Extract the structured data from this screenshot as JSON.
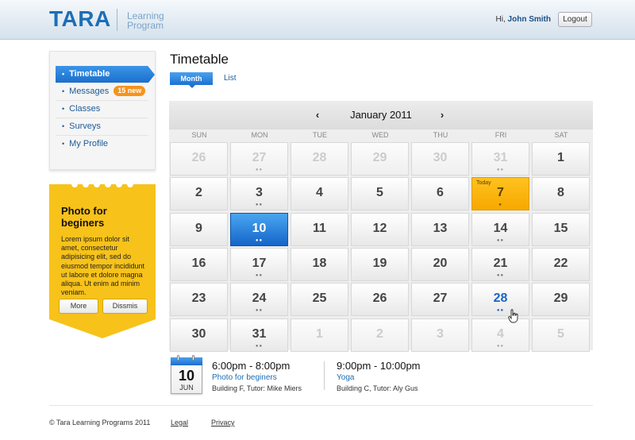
{
  "header": {
    "logo": "TARA",
    "logo_sub_1": "Learning",
    "logo_sub_2": "Program",
    "greeting": "Hi,",
    "user_name": "John Smith",
    "logout_label": "Logout"
  },
  "sidebar": {
    "items": [
      {
        "label": "Timetable",
        "active": true
      },
      {
        "label": "Messages",
        "badge": "15 new"
      },
      {
        "label": "Classes"
      },
      {
        "label": "Surveys"
      },
      {
        "label": "My Profile"
      }
    ]
  },
  "promo": {
    "title": "Photo for beginers",
    "body": "Lorem ipsum dolor sit amet, consectetur adipisicing elit, sed do eiusmod tempor incididunt ut labore et dolore magna aliqua. Ut enim ad minim veniam.",
    "more_label": "More",
    "dismiss_label": "Dissmis"
  },
  "main": {
    "title": "Timetable",
    "tab_month": "Month",
    "tab_list": "List"
  },
  "calendar": {
    "month": "January 2011",
    "prev_icon": "chevron-left-icon",
    "next_icon": "chevron-right-icon",
    "weekdays": [
      "SUN",
      "MON",
      "TUE",
      "WED",
      "THU",
      "FRI",
      "SAT"
    ],
    "today_label": "Today",
    "weeks": [
      [
        {
          "d": "26",
          "f": 1
        },
        {
          "d": "27",
          "f": 1,
          "e": 2
        },
        {
          "d": "28",
          "f": 1
        },
        {
          "d": "29",
          "f": 1
        },
        {
          "d": "30",
          "f": 1
        },
        {
          "d": "31",
          "f": 1,
          "e": 2
        },
        {
          "d": "1"
        }
      ],
      [
        {
          "d": "2"
        },
        {
          "d": "3",
          "e": 2
        },
        {
          "d": "4"
        },
        {
          "d": "5"
        },
        {
          "d": "6"
        },
        {
          "d": "7",
          "e": 1,
          "today": 1
        },
        {
          "d": "8"
        }
      ],
      [
        {
          "d": "9"
        },
        {
          "d": "10",
          "e": 2,
          "sel": 1
        },
        {
          "d": "11"
        },
        {
          "d": "12"
        },
        {
          "d": "13"
        },
        {
          "d": "14",
          "e": 2
        },
        {
          "d": "15"
        }
      ],
      [
        {
          "d": "16"
        },
        {
          "d": "17",
          "e": 2
        },
        {
          "d": "18"
        },
        {
          "d": "19"
        },
        {
          "d": "20"
        },
        {
          "d": "21",
          "e": 2
        },
        {
          "d": "22"
        }
      ],
      [
        {
          "d": "23"
        },
        {
          "d": "24",
          "e": 2
        },
        {
          "d": "25"
        },
        {
          "d": "26"
        },
        {
          "d": "27"
        },
        {
          "d": "28",
          "e": 2,
          "hl": 1
        },
        {
          "d": "29"
        }
      ],
      [
        {
          "d": "30"
        },
        {
          "d": "31",
          "e": 2
        },
        {
          "d": "1",
          "f": 1
        },
        {
          "d": "2",
          "f": 1
        },
        {
          "d": "3",
          "f": 1
        },
        {
          "d": "4",
          "f": 1,
          "e": 2
        },
        {
          "d": "5",
          "f": 1
        }
      ]
    ]
  },
  "selected_day": {
    "day": "10",
    "month": "JUN",
    "icon": "calendar-icon"
  },
  "events": [
    {
      "time": "6:00pm - 8:00pm",
      "name": "Photo for beginers",
      "location": "Building F, Tutor: Mike Miers"
    },
    {
      "time": "9:00pm - 10:00pm",
      "name": "Yoga",
      "location": "Building C, Tutor: Aly Gus"
    }
  ],
  "footer": {
    "copyright": "© Tara Learning Programs 2011",
    "legal": "Legal",
    "privacy": "Privacy"
  },
  "colors": {
    "brand_blue": "#1d6eb5",
    "today_orange": "#f6a800",
    "promo_yellow": "#f7c21a",
    "badge_orange": "#f6931d"
  }
}
